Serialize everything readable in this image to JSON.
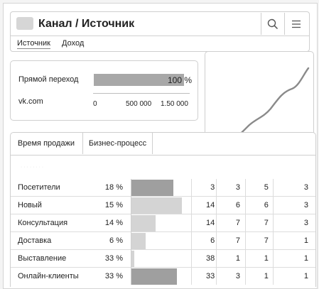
{
  "header": {
    "title": "Канал / Источник",
    "subtabs": [
      "Источник",
      "Доход"
    ]
  },
  "summary": {
    "rows": [
      {
        "label": "Прямой переход",
        "value_text": "100 %",
        "fraction": 1.0
      },
      {
        "label": "vk.com"
      }
    ],
    "axis_ticks": [
      "0",
      "500 000",
      "1.50 000"
    ]
  },
  "table_tabs": [
    "Время продажи",
    "Бизнес-процесс"
  ],
  "faint_text": "· · · · · · · ·",
  "table": {
    "rows": [
      {
        "name": "Посетители",
        "pct": "18 %",
        "bar": 0.6,
        "dark": true,
        "c1": "3",
        "c2": "3",
        "c3": "5",
        "c4": "3"
      },
      {
        "name": "Новый",
        "pct": "15 %",
        "bar": 0.72,
        "dark": false,
        "c1": "14",
        "c2": "6",
        "c3": "6",
        "c4": "3"
      },
      {
        "name": "Консультация",
        "pct": "14 %",
        "bar": 0.35,
        "dark": false,
        "c1": "14",
        "c2": "7",
        "c3": "7",
        "c4": "3"
      },
      {
        "name": "Доставка",
        "pct": "6 %",
        "bar": 0.2,
        "dark": false,
        "c1": "6",
        "c2": "7",
        "c3": "7",
        "c4": "1"
      },
      {
        "name": "Выставление",
        "pct": "33 %",
        "bar": 0.04,
        "dark": false,
        "c1": "38",
        "c2": "1",
        "c3": "1",
        "c4": "1"
      },
      {
        "name": "Онлайн-клиенты",
        "pct": "33 %",
        "bar": 0.65,
        "dark": true,
        "c1": "33",
        "c2": "3",
        "c3": "1",
        "c4": "1"
      }
    ]
  },
  "colors": {
    "bar_dark": "#9f9f9f",
    "bar_light": "#d4d4d4",
    "line": "#8a8a8a"
  },
  "icons": {
    "search": "search-icon",
    "menu": "menu-icon"
  }
}
